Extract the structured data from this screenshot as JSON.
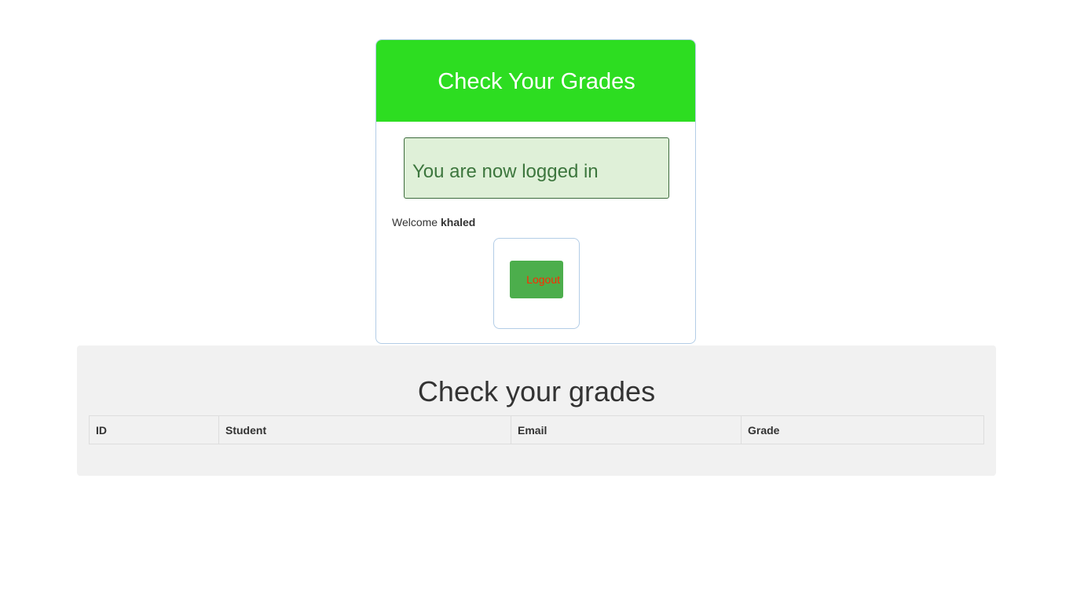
{
  "card": {
    "title": "Check Your Grades",
    "alert_text": "You are now logged in",
    "welcome_prefix": "Welcome ",
    "username": "khaled",
    "logout_label": "Logout"
  },
  "grades": {
    "title": "Check your grades",
    "columns": [
      "ID",
      "Student",
      "Email",
      "Grade"
    ],
    "rows": []
  },
  "colors": {
    "header_green": "#2ddd21",
    "alert_bg": "#dff0d8",
    "alert_text": "#3c763d",
    "logout_bg": "#4cae4c",
    "logout_text": "#ff2a00",
    "panel_bg": "#f1f1f1"
  }
}
